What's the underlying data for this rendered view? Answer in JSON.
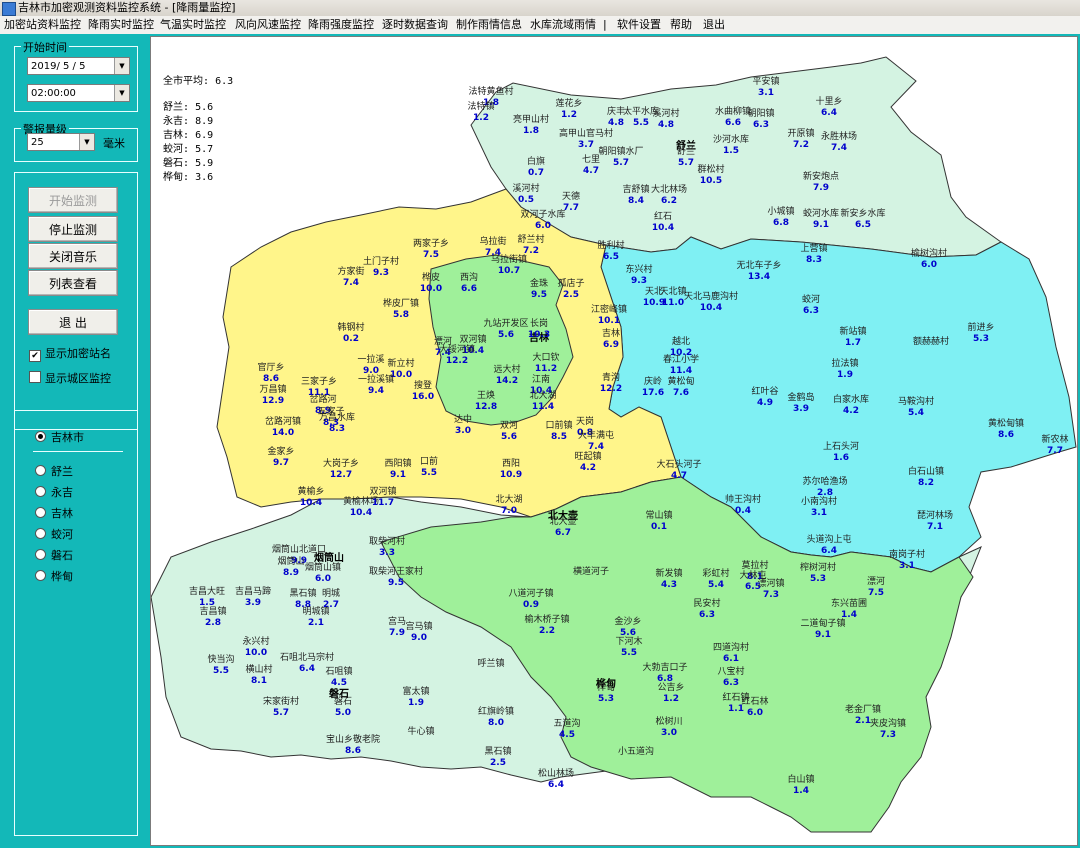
{
  "window": {
    "title": "吉林市加密观测资料监控系统 - [降雨量监控]"
  },
  "menu": [
    "加密站资料监控",
    "降雨实时监控",
    "气温实时监控",
    "风向风速监控",
    "降雨强度监控",
    "逐时数据查询",
    "制作雨情信息",
    "水库流域雨情",
    "|",
    "软件设置",
    "帮助",
    "退出"
  ],
  "sidebar": {
    "start_time": {
      "label": "开始时间",
      "date": "2019/ 5 / 5",
      "time": "02:00:00"
    },
    "alert": {
      "label": "警报量级",
      "value": "25",
      "unit": "毫米"
    },
    "buttons": {
      "start": "开始监测",
      "stop": "停止监测",
      "mute": "关闭音乐",
      "list": "列表查看",
      "exit": "退 出"
    },
    "checks": {
      "show_names": "显示加密站名",
      "city_zone": "显示城区监控"
    },
    "regions": [
      "吉林市",
      "舒兰",
      "永吉",
      "吉林",
      "蛟河",
      "磐石",
      "桦甸"
    ],
    "selected_region": "吉林市"
  },
  "stats": {
    "city_avg_label": "全市平均:",
    "city_avg_value": "6.3",
    "counties": [
      {
        "name": "舒兰:",
        "value": "5.6"
      },
      {
        "name": "永吉:",
        "value": "8.9"
      },
      {
        "name": "吉林:",
        "value": "6.9"
      },
      {
        "name": "蛟河:",
        "value": "5.7"
      },
      {
        "name": "磐石:",
        "value": "5.9"
      },
      {
        "name": "桦甸:",
        "value": "3.6"
      }
    ]
  },
  "map": {
    "colors": {
      "shulan": "#d4f3e2",
      "jiaohe": "#7ff0f3",
      "yongji": "#fff58a",
      "jilin": "#9ff09a",
      "panshi": "#d4f3e2",
      "huadian": "#9ff09a",
      "border": "#333333",
      "value": "#0000cc"
    },
    "county_labels": [
      "舒兰",
      "吉林",
      "烟筒山",
      "磐石",
      "北大壶",
      "桦甸"
    ],
    "stations": [
      {
        "n": "法特黄鱼村",
        "v": "1.8"
      },
      {
        "n": "法特镇",
        "v": "1.2"
      },
      {
        "n": "莲花乡",
        "v": "1.2"
      },
      {
        "n": "亮甲山村",
        "v": "1.8"
      },
      {
        "n": "庆丰",
        "v": "4.8"
      },
      {
        "n": "太平水库",
        "v": "5.5"
      },
      {
        "n": "溪河村",
        "v": "4.8"
      },
      {
        "n": "平安镇",
        "v": "3.1"
      },
      {
        "n": "十里乡",
        "v": "6.4"
      },
      {
        "n": "水曲柳镇",
        "v": "6.6"
      },
      {
        "n": "朝阳镇",
        "v": "6.3"
      },
      {
        "n": "开原镇",
        "v": "7.2"
      },
      {
        "n": "永胜林场",
        "v": "7.4"
      },
      {
        "n": "沙河水库",
        "v": "1.5"
      },
      {
        "n": "高甲山官马村",
        "v": "3.7"
      },
      {
        "n": "朝阳镇水厂",
        "v": "5.7"
      },
      {
        "n": "舒兰",
        "v": "5.7"
      },
      {
        "n": "白旗",
        "v": "0.7"
      },
      {
        "n": "七里",
        "v": "4.7"
      },
      {
        "n": "群松村",
        "v": "10.5"
      },
      {
        "n": "新安炮点",
        "v": "7.9"
      },
      {
        "n": "吉舒镇",
        "v": "8.4"
      },
      {
        "n": "大北林场",
        "v": "6.2"
      },
      {
        "n": "溪河村",
        "v": "0.5"
      },
      {
        "n": "天德",
        "v": "7.7"
      },
      {
        "n": "小城镇",
        "v": "6.8"
      },
      {
        "n": "蛟河水库",
        "v": "9.1"
      },
      {
        "n": "新安乡水库",
        "v": "6.5"
      },
      {
        "n": "双河子水库",
        "v": "6.0"
      },
      {
        "n": "红石",
        "v": "10.4"
      },
      {
        "n": "乌拉街",
        "v": "7.4"
      },
      {
        "n": "舒兰村",
        "v": "7.2"
      },
      {
        "n": "上营镇",
        "v": "8.3"
      },
      {
        "n": "榆树沟村",
        "v": "6.0"
      },
      {
        "n": "两家子乡",
        "v": "7.5"
      },
      {
        "n": "土门子村",
        "v": "9.3"
      },
      {
        "n": "乌拉街镇",
        "v": "10.7"
      },
      {
        "n": "胜利村",
        "v": "6.5"
      },
      {
        "n": "东兴村",
        "v": "9.3"
      },
      {
        "n": "无北车子乡",
        "v": "13.4"
      },
      {
        "n": "方家街",
        "v": "7.4"
      },
      {
        "n": "桦皮",
        "v": "10.0"
      },
      {
        "n": "西沟",
        "v": "6.6"
      },
      {
        "n": "金珠",
        "v": "9.5"
      },
      {
        "n": "孤店子",
        "v": "2.5"
      },
      {
        "n": "天北",
        "v": "10.9"
      },
      {
        "n": "天北镇",
        "v": "11.0"
      },
      {
        "n": "天北马鹿沟村",
        "v": "10.4"
      },
      {
        "n": "蛟河",
        "v": "6.3"
      },
      {
        "n": "桦皮厂镇",
        "v": "5.8"
      },
      {
        "n": "九站开发区",
        "v": "5.6"
      },
      {
        "n": "长岗",
        "v": "10.3"
      },
      {
        "n": "江密峰镇",
        "v": "10.1"
      },
      {
        "n": "前进乡",
        "v": "5.3"
      },
      {
        "n": "新站镇",
        "v": "1.7"
      },
      {
        "n": "额赫赫村",
        "v": ""
      },
      {
        "n": "韩钢村",
        "v": "0.2"
      },
      {
        "n": "双河镇",
        "v": "10.4"
      },
      {
        "n": "吉林",
        "v": "6.9"
      },
      {
        "n": "越北",
        "v": "10.2"
      },
      {
        "n": "漂河",
        "v": "7.4"
      },
      {
        "n": "大绥河镇",
        "v": "12.2"
      },
      {
        "n": "一拉溪",
        "v": "9.0"
      },
      {
        "n": "新立村",
        "v": "10.0"
      },
      {
        "n": "大口钦",
        "v": "11.2"
      },
      {
        "n": "春江小学",
        "v": "11.4"
      },
      {
        "n": "拉法镇",
        "v": "1.9"
      },
      {
        "n": "官厅乡",
        "v": "8.6"
      },
      {
        "n": "三家子乡",
        "v": "11.1"
      },
      {
        "n": "一拉溪镇",
        "v": "9.4"
      },
      {
        "n": "搜登",
        "v": "16.0"
      },
      {
        "n": "远大村",
        "v": "14.2"
      },
      {
        "n": "江南",
        "v": "10.4"
      },
      {
        "n": "青沟",
        "v": "12.2"
      },
      {
        "n": "庆岭",
        "v": "17.6"
      },
      {
        "n": "黄松甸",
        "v": "7.6"
      },
      {
        "n": "岔路河",
        "v": "8.9"
      },
      {
        "n": "万昌镇",
        "v": "12.9"
      },
      {
        "n": "北大湖",
        "v": "11.4"
      },
      {
        "n": "王焕",
        "v": "12.8"
      },
      {
        "n": "五家子",
        "v": "8.3"
      },
      {
        "n": "红叶谷",
        "v": "4.9"
      },
      {
        "n": "金鹤岛",
        "v": "3.9"
      },
      {
        "n": "白家水库",
        "v": "4.2"
      },
      {
        "n": "马鞍沟村",
        "v": "5.4"
      },
      {
        "n": "岔路河镇",
        "v": "14.0"
      },
      {
        "n": "西阳镇",
        "v": "9.1"
      },
      {
        "n": "万昌水库",
        "v": "8.3"
      },
      {
        "n": "达中",
        "v": "3.0"
      },
      {
        "n": "双河",
        "v": "5.6"
      },
      {
        "n": "口前镇",
        "v": "8.5"
      },
      {
        "n": "天岗",
        "v": "0.8"
      },
      {
        "n": "黄松甸镇",
        "v": "8.6"
      },
      {
        "n": "金家乡",
        "v": "9.7"
      },
      {
        "n": "大岗子乡",
        "v": "12.7"
      },
      {
        "n": "口前",
        "v": "5.5"
      },
      {
        "n": "西阳",
        "v": "10.9"
      },
      {
        "n": "大丰满屯",
        "v": "7.4"
      },
      {
        "n": "上石头河",
        "v": "1.6"
      },
      {
        "n": "白石山镇",
        "v": "8.2"
      },
      {
        "n": "新农林",
        "v": "7.7"
      },
      {
        "n": "旺起镇",
        "v": "4.2"
      },
      {
        "n": "大石头河子",
        "v": "4.7"
      },
      {
        "n": "苏尔哈渔场",
        "v": "2.8"
      },
      {
        "n": "小南沟村",
        "v": "3.1"
      },
      {
        "n": "黄榆乡",
        "v": "10.4"
      },
      {
        "n": "黄榆林场",
        "v": "10.4"
      },
      {
        "n": "双河镇",
        "v": "11.7"
      },
      {
        "n": "北大湖",
        "v": "7.0"
      },
      {
        "n": "帅王沟村",
        "v": "0.4"
      },
      {
        "n": "琵河林场",
        "v": "7.1"
      },
      {
        "n": "常山镇",
        "v": "0.1"
      },
      {
        "n": "头道沟上屯",
        "v": "6.4"
      },
      {
        "n": "北大壶",
        "v": "6.7"
      },
      {
        "n": "烟筒山北道口",
        "v": "9.9"
      },
      {
        "n": "取柴河村",
        "v": "3.3"
      },
      {
        "n": "莫拉村",
        "v": "8.1"
      },
      {
        "n": "榨树河村",
        "v": "5.3"
      },
      {
        "n": "南岗子村",
        "v": "3.1"
      },
      {
        "n": "烟筒山",
        "v": "8.9"
      },
      {
        "n": "烟筒山镇",
        "v": "6.0"
      },
      {
        "n": "取柴河王家村",
        "v": "9.5"
      },
      {
        "n": "横道河子",
        "v": ""
      },
      {
        "n": "新发镇",
        "v": "4.3"
      },
      {
        "n": "彩虹村",
        "v": "5.4"
      },
      {
        "n": "大林屯",
        "v": "6.5"
      },
      {
        "n": "漂河镇",
        "v": "7.3"
      },
      {
        "n": "漂河",
        "v": "7.5"
      },
      {
        "n": "吉昌大旺",
        "v": "1.5"
      },
      {
        "n": "吉昌马蹄",
        "v": "3.9"
      },
      {
        "n": "黑石镇",
        "v": "8.8"
      },
      {
        "n": "明城",
        "v": "2.7"
      },
      {
        "n": "八道河子镇",
        "v": "0.9"
      },
      {
        "n": "民安村",
        "v": "6.3"
      },
      {
        "n": "东兴苗圃",
        "v": "1.4"
      },
      {
        "n": "吉昌镇",
        "v": "2.8"
      },
      {
        "n": "明城镇",
        "v": "2.1"
      },
      {
        "n": "宫马",
        "v": "7.9"
      },
      {
        "n": "宫马镇",
        "v": "9.0"
      },
      {
        "n": "榆木桥子镇",
        "v": "2.2"
      },
      {
        "n": "金沙乡",
        "v": "5.6"
      },
      {
        "n": "二道甸子镇",
        "v": "9.1"
      },
      {
        "n": "永兴村",
        "v": "10.0"
      },
      {
        "n": "下河木",
        "v": "5.5"
      },
      {
        "n": "四道沟村",
        "v": "6.1"
      },
      {
        "n": "快当沟",
        "v": "5.5"
      },
      {
        "n": "石咀北马宗村",
        "v": "6.4"
      },
      {
        "n": "大勃吉口子",
        "v": "6.8"
      },
      {
        "n": "八宝村",
        "v": "6.3"
      },
      {
        "n": "横山村",
        "v": "8.1"
      },
      {
        "n": "石咀镇",
        "v": "4.5"
      },
      {
        "n": "呼兰镇",
        "v": ""
      },
      {
        "n": "桦甸",
        "v": "5.3"
      },
      {
        "n": "公吉乡",
        "v": "1.2"
      },
      {
        "n": "红石镇",
        "v": "1.1"
      },
      {
        "n": "宋家街村",
        "v": "5.7"
      },
      {
        "n": "磐石",
        "v": "5.0"
      },
      {
        "n": "富太镇",
        "v": "1.9"
      },
      {
        "n": "红石林",
        "v": "6.0"
      },
      {
        "n": "红旗岭镇",
        "v": "8.0"
      },
      {
        "n": "五道沟",
        "v": "4.5"
      },
      {
        "n": "松树川",
        "v": "3.0"
      },
      {
        "n": "老金厂镇",
        "v": "2.1"
      },
      {
        "n": "夹皮沟镇",
        "v": "7.3"
      },
      {
        "n": "牛心镇",
        "v": ""
      },
      {
        "n": "宝山乡敬老院",
        "v": "8.6"
      },
      {
        "n": "黑石镇",
        "v": "2.5"
      },
      {
        "n": "小五道沟",
        "v": ""
      },
      {
        "n": "松山林场",
        "v": "6.4"
      },
      {
        "n": "白山镇",
        "v": "1.4"
      }
    ]
  }
}
